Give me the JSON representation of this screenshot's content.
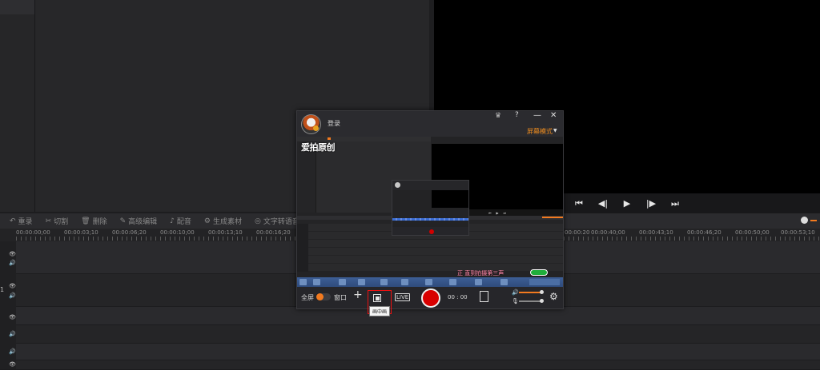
{
  "toolbar": {
    "items": [
      {
        "icon": "undo-icon",
        "glyph": "↶",
        "label": "重录"
      },
      {
        "icon": "scissors-icon",
        "glyph": "✂",
        "label": "切割"
      },
      {
        "icon": "trash-icon",
        "glyph": "🗑",
        "label": "删除"
      },
      {
        "icon": "edit-icon",
        "glyph": "✎",
        "label": "高级编辑"
      },
      {
        "icon": "mic-icon",
        "glyph": "♪",
        "label": "配音"
      },
      {
        "icon": "material-icon",
        "glyph": "⚙",
        "label": "生成素材"
      },
      {
        "icon": "text-icon",
        "glyph": "◎",
        "label": "文字转语音"
      }
    ]
  },
  "ruler": {
    "ticks": [
      "00:00:00;00",
      "00:00:03;10",
      "00:00:06;20",
      "00:00:10;00",
      "00:00:13;10",
      "00:00:16;20",
      "00:00:20",
      "00:00:40;00",
      "00:00:43;10",
      "00:00:46;20",
      "00:00:50;00",
      "00:00:53;10"
    ]
  },
  "tracks": {
    "number_label": "1"
  },
  "recorder": {
    "login_label": "登录",
    "mode_label": "屏幕模式",
    "nested_logo": "爱拍原创",
    "caption": "正 直到拍摄第三声",
    "fullscreen_label": "全屏",
    "window_label": "窗口",
    "camera_label": "LIVE",
    "timer": "00 : 00",
    "pip_tooltip": "画中画"
  },
  "colors": {
    "accent": "#f37a1f",
    "record": "#d80000",
    "highlight_border": "#e11111"
  }
}
